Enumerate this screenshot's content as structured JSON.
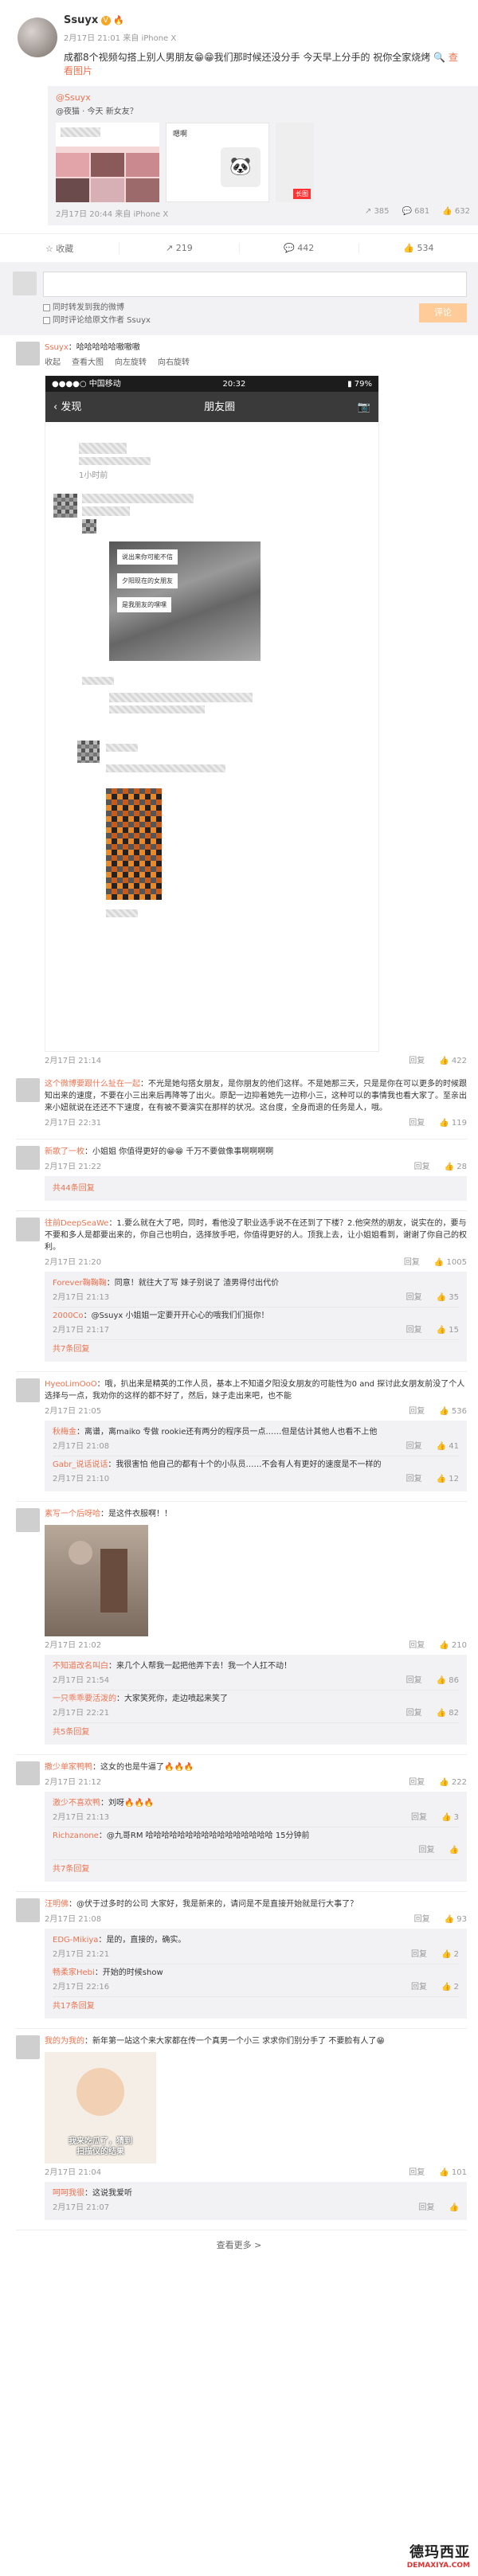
{
  "post": {
    "username": "Ssuyx",
    "meta": "2月17日 21:01 来自 iPhone X",
    "text": "成都8个视频勾搭上别人男朋友😁😁我们那时候还没分手 今天早上分手的 祝你全家烧烤",
    "view_pics": "查看图片",
    "repost": {
      "author": "@Ssuyx",
      "text": "@夜猫 · 今天 新女友？",
      "thumb_label": "嗯啊",
      "red_tag": "长图",
      "meta": "2月17日 20:44 来自 iPhone X",
      "stats": [
        "385",
        "681",
        "632"
      ]
    },
    "actions": [
      "收藏",
      "219",
      "442",
      "534"
    ]
  },
  "comment_box": {
    "opt1": "同时转发到我的微博",
    "opt2": "同时评论给原文作者 Ssuyx",
    "send": "评论"
  },
  "first_comment": {
    "author": "Ssuyx",
    "text": "：哈哈哈哈哈嗷嗷嗷",
    "tools": [
      "收起",
      "查看大图",
      "向左旋转",
      "向右旋转"
    ],
    "phone": {
      "carrier": "●●●●○ 中国移动",
      "time": "20:32",
      "battery": "79%",
      "back": "发现",
      "title": "朋友圈",
      "ago": "1小时前",
      "bubbles": [
        "说出来你可能不信",
        "夕阳现在的女朋友",
        "是我朋友的嘿嘿"
      ]
    },
    "time": "2月17日 21:14",
    "likes": "422"
  },
  "comments": [
    {
      "author": "这个微博要跟什么扯在一起",
      "text": "：不光是她勾搭女朋友，是你朋友的他们这样。不是她那三天，只是是你在可以更多的时候跟知出来的速度，不要在小三出来后再降等了出火。原配一边抑着她先一边称小三，这种可以的事情我也看大家了。至亲出来小妞就说在还还不下速度，在有被不要演实在那样的状况。这台度，全身而退的任务是人，哦。",
      "time": "2月17日 22:31",
      "likes": "119",
      "replies": []
    },
    {
      "author": "新歌了一枚",
      "text": "：小姐姐 你值得更好的😁😁 千万不要做像事啊啊啊啊",
      "time": "2月17日 21:22",
      "likes": "28",
      "replies": [],
      "more": "共44条回复"
    },
    {
      "author": "往前DeepSeaWe",
      "text": "：1.要么就在大了吧，同时，看他没了职业选手说不在还到了下楼？2.他突然的朋友，说实在的，要与不要和多人是都要出来的，你自己也明白，选择放手吧，你值得更好的人。顶我上去，让小姐姐看到，谢谢了你自己的权利。",
      "time": "2月17日 21:20",
      "likes": "1005",
      "replies": [
        {
          "author": "Forever鞠鞠鞠",
          "text": "：同意！就往大了写 妹子别说了 渣男得付出代价",
          "time": "2月17日 21:13",
          "likes": "35"
        },
        {
          "author": "2000Co",
          "text": "：@Ssuyx 小姐姐一定要开开心心的哦我们们挺你！",
          "time": "2月17日 21:17",
          "likes": "15"
        }
      ],
      "more": "共7条回复"
    },
    {
      "author": "HyeoLimOoO",
      "text": "：哦，扒出来是精英的工作人员，基本上不知道夕阳没女朋友的可能性为0 and 探讨此女朋友前没了个人选择与一点，我劝你的这样的都不好了，然后，妹子走出来吧，也不能",
      "time": "2月17日 21:05",
      "likes": "536",
      "replies": [
        {
          "author": "秋梅金",
          "text": "：离谱，离maiko 专做 rookie还有两分的程序员一点……但是估计其他人也看不上他",
          "time": "2月17日 21:08",
          "likes": "41"
        },
        {
          "author": "Gabr_说话说话",
          "text": "：我很害怕 他自己的都有十个的小队员……不会有人有更好的速度是不一样的",
          "time": "2月17日 21:10",
          "likes": "12"
        }
      ],
      "more": ""
    },
    {
      "author": "素写一个后呀哈",
      "text": "：是这件衣服啊！！",
      "time": "2月17日 21:02",
      "likes": "210",
      "replies": [
        {
          "author": "不知道改名叫白",
          "text": "：来几个人帮我一起把他弄下去！我一个人扛不动！",
          "time": "2月17日 21:54",
          "likes": "86"
        },
        {
          "author": "一只乖乖要活泼的",
          "text": "：大家笑死你，走边喷起来笑了",
          "time": "2月17日 22:21",
          "likes": "82"
        }
      ],
      "more": "共5条回复"
    },
    {
      "author": "撒少单家鸭鸭",
      "text": "：这女的也是牛逼了🔥🔥🔥",
      "time": "2月17日 21:12",
      "likes": "222",
      "replies": [
        {
          "author": "激少不喜欢鸭",
          "text": "：刘呀🔥🔥🔥",
          "time": "2月17日 21:13",
          "likes": "3"
        },
        {
          "author": "Richzanone",
          "text": "：@九哥RM 哈哈哈哈哈哈哈哈哈哈哈哈哈哈哈哈 15分钟前",
          "time": "",
          "likes": ""
        }
      ],
      "more": "共7条回复"
    },
    {
      "author": "汪明佛",
      "text": "：@伏于过多时的公司 大家好，我是新来的，请问是不是直接开始就是行大事了？",
      "time": "2月17日 21:08",
      "likes": "93",
      "replies": [
        {
          "author": "EDG-Mikiya",
          "text": "：是的，直接的，确实。",
          "time": "2月17日 21:21",
          "likes": "2"
        },
        {
          "author": "畅柔家Hebi",
          "text": "：开始的时候show",
          "time": "2月17日 22:16",
          "likes": "2"
        }
      ],
      "more": "共17条回复"
    },
    {
      "author": "我的为我的",
      "text": "：新年第一站这个来大家都在传一个真男一个小三 求求你们别分手了 不要脸有人了😁",
      "time": "2月17日 21:04",
      "likes": "101",
      "replies": [
        {
          "author": "呵呵我很",
          "text": "：这说我爱听",
          "time": "2月17日 21:07",
          "likes": ""
        }
      ],
      "more": ""
    }
  ],
  "meme_caption": [
    "我来吃瓜了，猜到",
    "扫描仪的结果"
  ],
  "see_more": "查看更多 >",
  "watermark": {
    "cn": "德玛西亚",
    "en": "DEMAXIYA.COM"
  }
}
